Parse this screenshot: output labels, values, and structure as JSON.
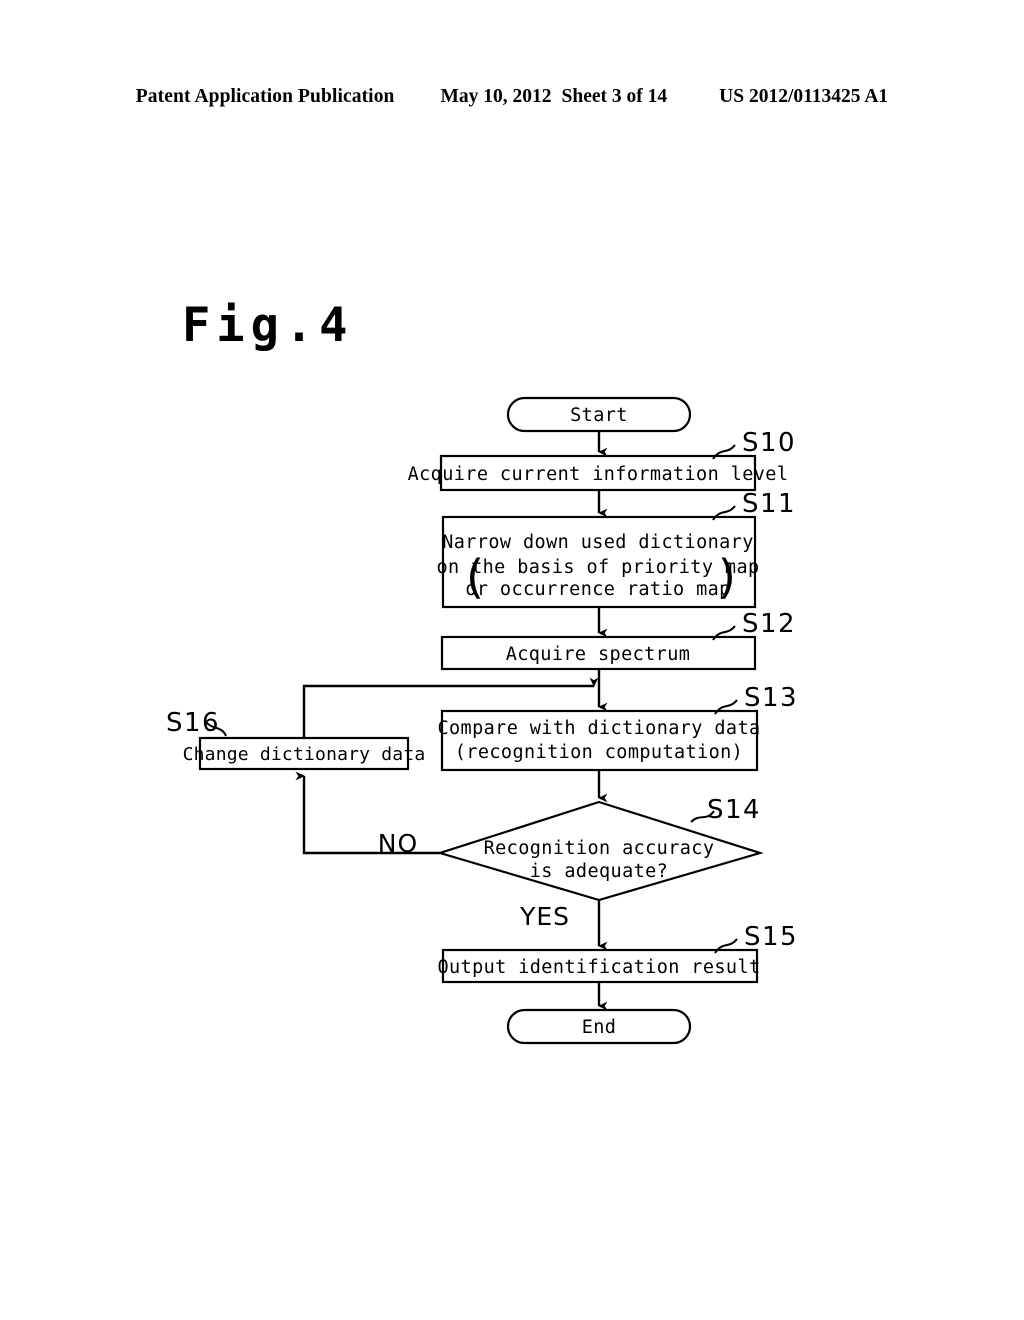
{
  "header": {
    "publication": "Patent Application Publication",
    "date": "May 10, 2012",
    "sheet": "Sheet 3 of 14",
    "patent_number": "US 2012/0113425 A1"
  },
  "figure": {
    "title": "Fig.4"
  },
  "flowchart": {
    "start": {
      "label": "Start"
    },
    "end": {
      "label": "End"
    },
    "steps": [
      {
        "id": "S10",
        "tag": "S10",
        "lines": [
          "Acquire current information level"
        ]
      },
      {
        "id": "S11",
        "tag": "S11",
        "lines": [
          "Narrow down used dictionary",
          "on the basis of priority map",
          "or occurrence ratio map"
        ],
        "paren_open": "(",
        "paren_close": ")"
      },
      {
        "id": "S12",
        "tag": "S12",
        "lines": [
          "Acquire spectrum"
        ]
      },
      {
        "id": "S13",
        "tag": "S13",
        "lines": [
          "Compare with dictionary data",
          "(recognition computation)"
        ]
      },
      {
        "id": "S14",
        "tag": "S14",
        "lines": [
          "Recognition accuracy",
          "is adequate?"
        ],
        "branch_no": "NO",
        "branch_yes": "YES"
      },
      {
        "id": "S15",
        "tag": "S15",
        "lines": [
          "Output identification result"
        ]
      },
      {
        "id": "S16",
        "tag": "S16",
        "lines": [
          "Change dictionary data"
        ]
      }
    ]
  },
  "colors": {
    "ink": "#000000",
    "paper": "#ffffff"
  }
}
